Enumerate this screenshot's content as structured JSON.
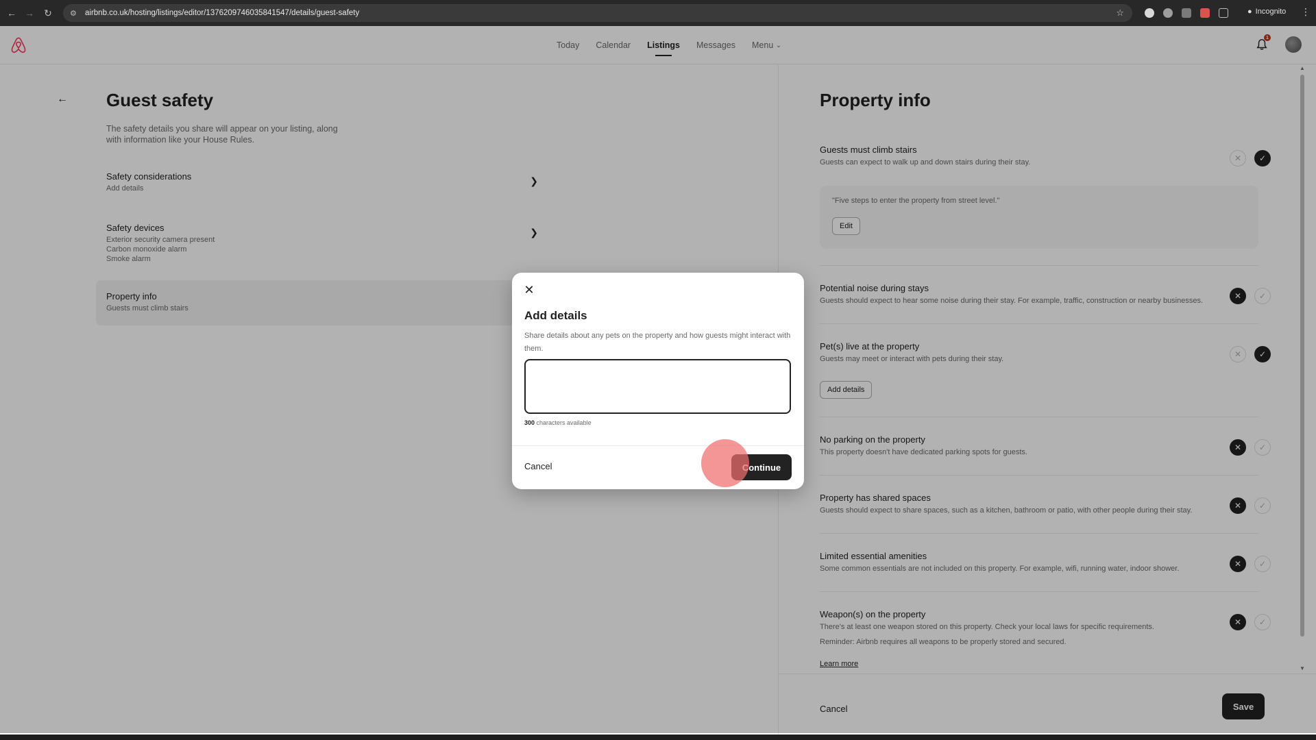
{
  "browser": {
    "url": "airbnb.co.uk/hosting/listings/editor/1376209746035841547/details/guest-safety",
    "mode_label": "Incognito",
    "icons": [
      "back-icon",
      "forward-icon",
      "reload-icon",
      "site-info-icon",
      "star-icon",
      "extensions-icon",
      "incognito-icon",
      "menu-icon"
    ]
  },
  "header": {
    "nav": [
      {
        "label": "Today",
        "active": false
      },
      {
        "label": "Calendar",
        "active": false
      },
      {
        "label": "Listings",
        "active": true
      },
      {
        "label": "Messages",
        "active": false
      },
      {
        "label": "Menu",
        "active": false
      }
    ],
    "notification_count": "1",
    "brand_color": "#FF385C"
  },
  "left": {
    "title": "Guest safety",
    "description": "The safety details you share will appear on your listing, along with information like your House Rules.",
    "sections": [
      {
        "title": "Safety considerations",
        "sub": [
          "Add details"
        ]
      },
      {
        "title": "Safety devices",
        "sub": [
          "Exterior security camera present",
          "Carbon monoxide alarm",
          "Smoke alarm"
        ]
      },
      {
        "title": "Property info",
        "sub": [
          "Guests must climb stairs"
        ]
      }
    ]
  },
  "right": {
    "title": "Property info",
    "items": [
      {
        "title": "Guests must climb stairs",
        "desc": "Guests can expect to walk up and down stairs during their stay.",
        "value": "yes",
        "detail_quote": "\"Five steps to enter the property from street level.\"",
        "detail_button": "Edit"
      },
      {
        "title": "Potential noise during stays",
        "desc": "Guests should expect to hear some noise during their stay. For example, traffic, construction or nearby businesses.",
        "value": "no"
      },
      {
        "title": "Pet(s) live at the property",
        "desc": "Guests may meet or interact with pets during their stay.",
        "value": "yes",
        "detail_button": "Add details"
      },
      {
        "title": "No parking on the property",
        "desc": "This property doesn't have dedicated parking spots for guests.",
        "value": "no"
      },
      {
        "title": "Property has shared spaces",
        "desc": "Guests should expect to share spaces, such as a kitchen, bathroom or patio, with other people during their stay.",
        "value": "no"
      },
      {
        "title": "Limited essential amenities",
        "desc": "Some common essentials are not included on this property. For example, wifi, running water, indoor shower.",
        "value": "no"
      },
      {
        "title": "Weapon(s) on the property",
        "desc": "There's at least one weapon stored on this property. Check your local laws for specific requirements.",
        "note": "Reminder: Airbnb requires all weapons to be properly stored and secured.",
        "link": "Learn more",
        "value": "no"
      }
    ],
    "footer": {
      "cancel": "Cancel",
      "save": "Save"
    }
  },
  "modal": {
    "title": "Add details",
    "description": "Share details about any pets on the property and how guests might interact with them.",
    "textarea_value": "",
    "counter_number": "300",
    "counter_suffix": " characters available",
    "cancel": "Cancel",
    "continue": "Continue"
  }
}
